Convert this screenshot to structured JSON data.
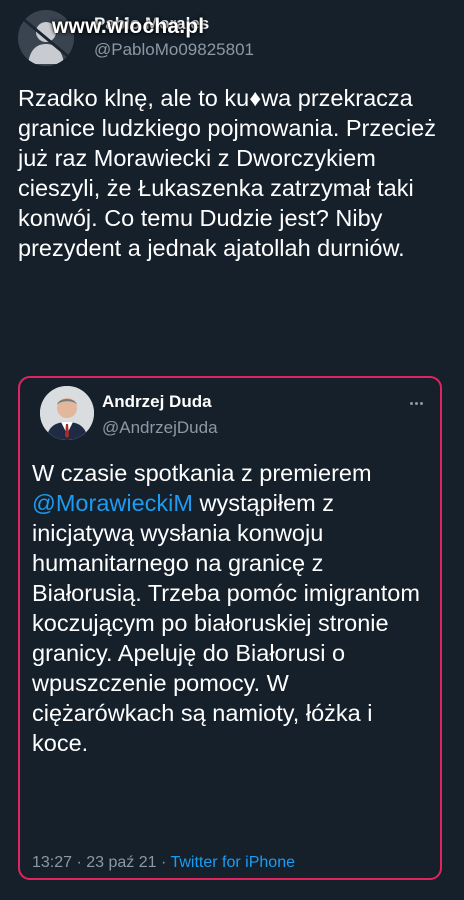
{
  "outer_tweet": {
    "display_name": "Pablo Morales",
    "handle": "@PabloMo09825801",
    "watermark": "www.wiocha.pl",
    "text": "Rzadko klnę, ale to ku♦wa przekracza granice ludzkiego pojmowania. Przecież już raz Morawiecki z Dworczykiem cieszyli, że Łukaszenka zatrzymał taki konwój. Co temu Dudzie jest? Niby prezydent a jednak ajatollah durniów."
  },
  "quoted_tweet": {
    "display_name": "Andrzej Duda",
    "handle": "@AndrzejDuda",
    "text_before": "W czasie spotkania z premierem ",
    "mention": "@MorawieckiM",
    "text_after": " wystąpiłem z inicjatywą wysłania konwoju humanitarnego na granicę z Białorusią. Trzeba pomóc imigrantom koczującym po białoruskiej stronie granicy. Apeluję do Białorusi o wpuszczenie pomocy. W ciężarówkach są namioty, łóżka i koce.",
    "time": "13:27",
    "separator": " · ",
    "date": "23 paź 21",
    "source": "Twitter for iPhone"
  },
  "colors": {
    "background": "#15202b",
    "text": "#ffffff",
    "secondary": "#8b98a5",
    "link": "#1d9bf0",
    "highlight_border": "#e0245e"
  },
  "icons": {
    "outer_avatar": "user-avatar-icon",
    "quote_avatar": "user-avatar-icon",
    "more": "more-horizontal-icon"
  }
}
